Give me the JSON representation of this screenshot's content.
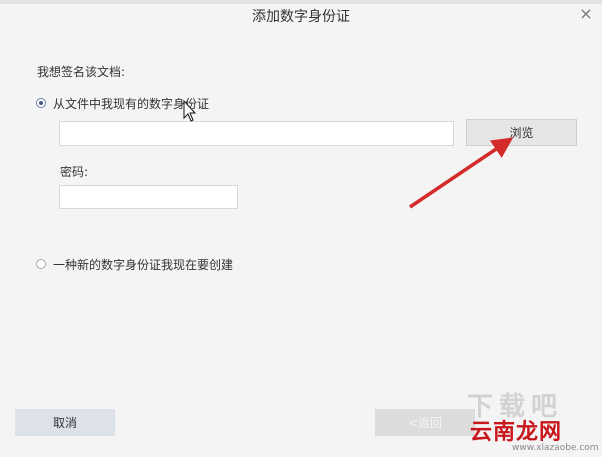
{
  "dialog": {
    "title": "添加数字身份证",
    "close_glyph": "×"
  },
  "prompt": "我想签名该文档:",
  "options": [
    {
      "label": "从文件中我现有的数字身份证",
      "selected": true
    },
    {
      "label": "一种新的数字身份证我现在要创建",
      "selected": false
    }
  ],
  "file_path": {
    "value": "",
    "placeholder": ""
  },
  "browse_label": "浏览",
  "password": {
    "label": "密码:",
    "value": ""
  },
  "footer": {
    "cancel_label": "取消",
    "back_label": "<返回"
  },
  "watermark": {
    "brand": "云南龙网",
    "url": "www.xlazaobe.com"
  },
  "colors": {
    "background": "#f4f4f4",
    "annotation_arrow": "#d32a2a",
    "cancel_button": "#dde2ea"
  },
  "icons": [
    "close-icon",
    "radio-checked",
    "radio-unchecked",
    "mouse-cursor-icon",
    "annotation-arrow"
  ]
}
